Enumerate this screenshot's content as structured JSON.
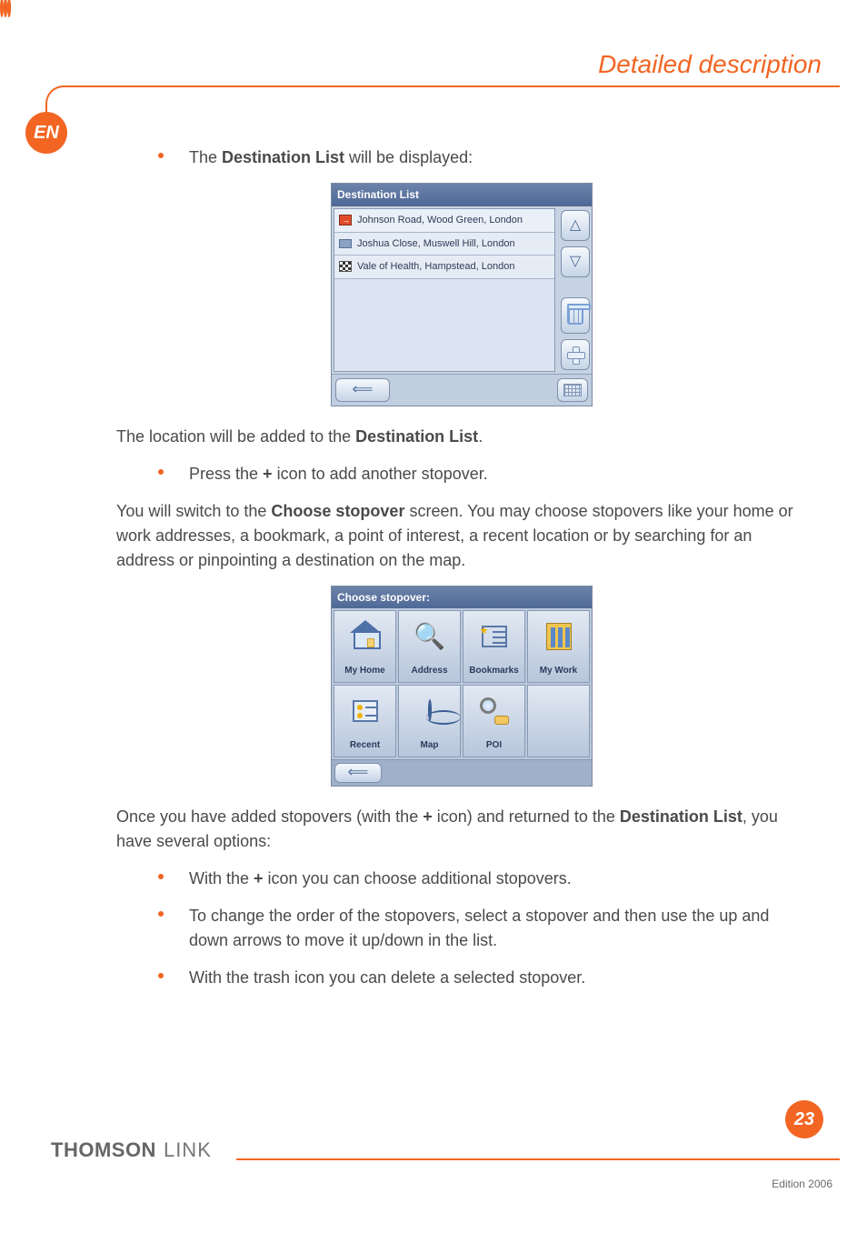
{
  "header": {
    "title": "Detailed description"
  },
  "lang_badge": "EN",
  "para1": {
    "prefix": "The ",
    "bold": "Destination List",
    "suffix": " will be displayed:"
  },
  "dest_list": {
    "title": "Destination List",
    "rows": [
      "Johnson Road, Wood Green, London",
      "Joshua Close, Muswell Hill, London",
      "Vale of Health, Hampstead, London"
    ]
  },
  "para2": {
    "a": "The location will be added to the ",
    "b": "Destination List",
    "c": "."
  },
  "bullet2": {
    "a": "Press the ",
    "plus": "+",
    "b": " icon to add another stopover."
  },
  "para3": {
    "a": "You will switch to the ",
    "b": "Choose stopover",
    "c": " screen. You may choose stopovers like your home or work addresses, a bookmark, a point of interest, a recent location or by searching for an address or pinpointing a destination on the map."
  },
  "stopover": {
    "title": "Choose stopover:",
    "cells": [
      "My Home",
      "Address",
      "Bookmarks",
      "My Work",
      "Recent",
      "Map",
      "POI"
    ]
  },
  "para4": {
    "a": "Once you have added stopovers (with the ",
    "plus": "+",
    "b": " icon) and returned to the ",
    "c": "Destination List",
    "d": ", you have several options:"
  },
  "bullets3": [
    {
      "a": "With the ",
      "plus": "+",
      "b": " icon you can choose additional stopovers."
    },
    {
      "text": "To change the order of the stopovers, select a stopover and then use the up and down arrows to move it up/down in the list."
    },
    {
      "text": "With the trash icon you can delete a selected stopover."
    }
  ],
  "page_number": "23",
  "brand": {
    "thomson": "THOMSON",
    "link": "LINK"
  },
  "edition": "Edition 2006"
}
